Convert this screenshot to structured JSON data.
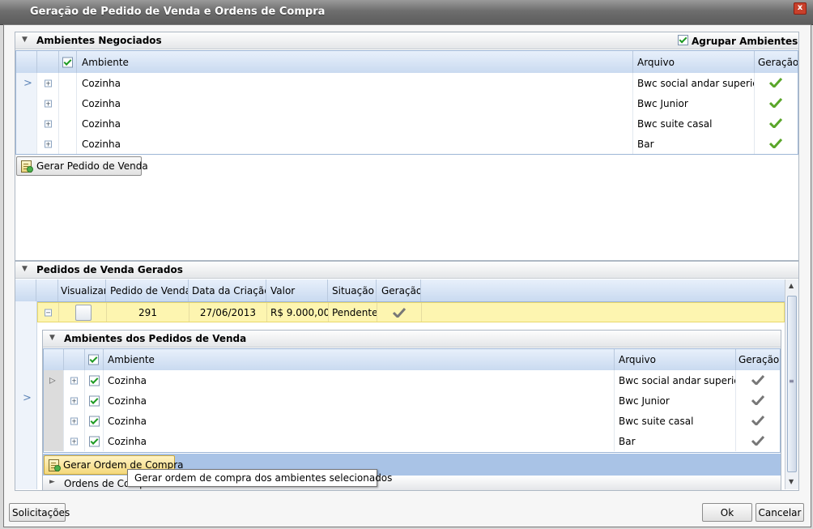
{
  "window": {
    "title": "Geração de Pedido de Venda e Ordens de Compra",
    "close_label": "x"
  },
  "ambientes": {
    "section_title": "Ambientes Negociados",
    "agrupar_label": "Agrupar Ambientes",
    "agrupar_checked": true,
    "columns": {
      "ambiente": "Ambiente",
      "arquivo": "Arquivo",
      "geracao": "Geração"
    },
    "rows": [
      {
        "ambiente": "Cozinha",
        "arquivo": "Bwc social andar superior",
        "geracao": true
      },
      {
        "ambiente": "Cozinha",
        "arquivo": "Bwc Junior",
        "geracao": true
      },
      {
        "ambiente": "Cozinha",
        "arquivo": "Bwc suite casal",
        "geracao": true
      },
      {
        "ambiente": "Cozinha",
        "arquivo": "Bar",
        "geracao": true
      }
    ],
    "gerar_button": "Gerar Pedido de Venda"
  },
  "pedidos": {
    "section_title": "Pedidos de Venda Gerados",
    "columns": {
      "visualizar": "Visualizar",
      "pedido": "Pedido de Venda",
      "data": "Data da Criação",
      "valor": "Valor",
      "situacao": "Situação",
      "geracao": "Geração"
    },
    "row": {
      "pedido": "291",
      "data": "27/06/2013",
      "valor": "R$ 9.000,00",
      "situacao": "Pendente"
    },
    "sub": {
      "section_title": "Ambientes dos Pedidos de Venda",
      "columns": {
        "ambiente": "Ambiente",
        "arquivo": "Arquivo",
        "geracao": "Geração"
      },
      "rows": [
        {
          "ambiente": "Cozinha",
          "arquivo": "Bwc social andar superior"
        },
        {
          "ambiente": "Cozinha",
          "arquivo": "Bwc Junior"
        },
        {
          "ambiente": "Cozinha",
          "arquivo": "Bwc suite casal"
        },
        {
          "ambiente": "Cozinha",
          "arquivo": "Bar"
        }
      ],
      "gerar_button": "Gerar Ordem de Compra",
      "tooltip": "Gerar ordem de compra dos ambientes selecionados",
      "ordens_title": "Ordens de Compra Geradas"
    }
  },
  "footer": {
    "solicitacoes": "Solicitações",
    "ok": "Ok",
    "cancelar": "Cancelar"
  },
  "colors": {
    "title_bg": "#6e6e6e",
    "grid_header": "#c9daf0",
    "selected_row": "#fdf5b0",
    "accent_green": "#1e9a23"
  }
}
